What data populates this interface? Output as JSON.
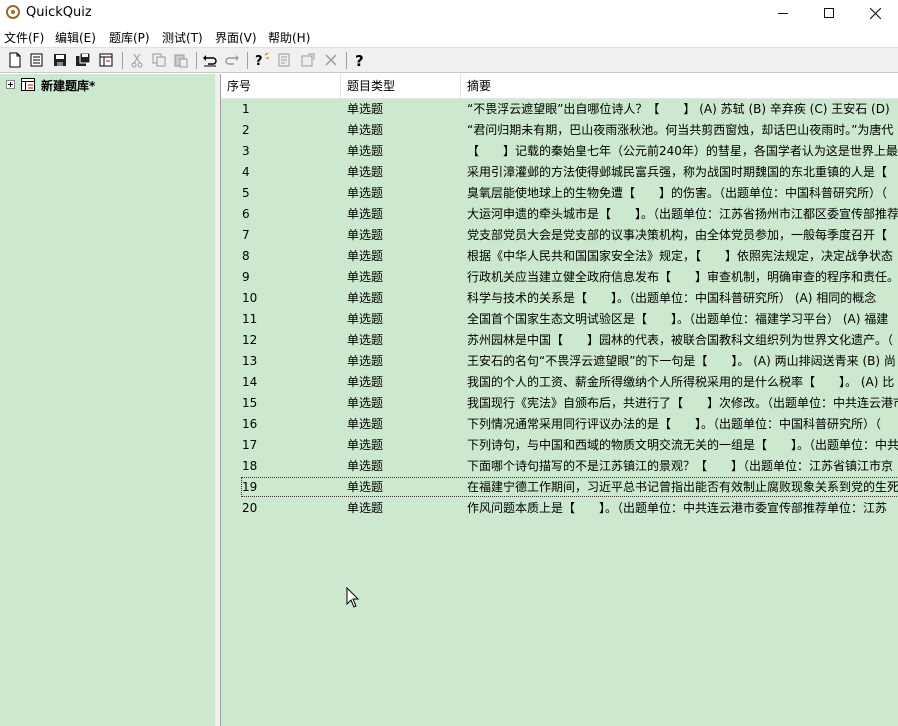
{
  "window": {
    "title": "QuickQuiz"
  },
  "menu": [
    {
      "label": "文件(F)"
    },
    {
      "label": "编辑(E)"
    },
    {
      "label": "题库(P)"
    },
    {
      "label": "测试(T)"
    },
    {
      "label": "界面(V)"
    },
    {
      "label": "帮助(H)"
    }
  ],
  "tree": {
    "root_label": "新建题库*"
  },
  "list": {
    "columns": [
      "序号",
      "题目类型",
      "摘要"
    ],
    "rows": [
      {
        "num": "1",
        "type": "单选题",
        "summary": "“不畏浮云遮望眼”出自哪位诗人？【　　】 (A) 苏轼 (B) 辛弃疾 (C) 王安石 (D)"
      },
      {
        "num": "2",
        "type": "单选题",
        "summary": "“君问归期未有期，巴山夜雨涨秋池。何当共剪西窗烛，却话巴山夜雨时。”为唐代"
      },
      {
        "num": "3",
        "type": "单选题",
        "summary": "【　　】记载的秦始皇七年（公元前240年）的彗星，各国学者认为这是世界上最早"
      },
      {
        "num": "4",
        "type": "单选题",
        "summary": "采用引漳灌邺的方法使得邺城民富兵强，称为战国时期魏国的东北重镇的人是【"
      },
      {
        "num": "5",
        "type": "单选题",
        "summary": "臭氧层能使地球上的生物免遭【　　】的伤害。（出题单位：中国科普研究所）（"
      },
      {
        "num": "6",
        "type": "单选题",
        "summary": "大运河申遗的牵头城市是【　　】。（出题单位：江苏省扬州市江都区委宣传部推荐"
      },
      {
        "num": "7",
        "type": "单选题",
        "summary": "党支部党员大会是党支部的议事决策机构，由全体党员参加，一般每季度召开【"
      },
      {
        "num": "8",
        "type": "单选题",
        "summary": "根据《中华人民共和国国家安全法》规定，【　　】依照宪法规定，决定战争状态"
      },
      {
        "num": "9",
        "type": "单选题",
        "summary": "行政机关应当建立健全政府信息发布【　　】审查机制，明确审查的程序和责任。"
      },
      {
        "num": "10",
        "type": "单选题",
        "summary": "科学与技术的关系是【　　】。（出题单位：中国科普研究所） (A) 相同的概念"
      },
      {
        "num": "11",
        "type": "单选题",
        "summary": "全国首个国家生态文明试验区是【　　】。（出题单位：福建学习平台） (A) 福建"
      },
      {
        "num": "12",
        "type": "单选题",
        "summary": "苏州园林是中国【　　】园林的代表，被联合国教科文组织列为世界文化遗产。（"
      },
      {
        "num": "13",
        "type": "单选题",
        "summary": "王安石的名句“不畏浮云遮望眼”的下一句是【　　】。 (A) 两山排闼送青来 (B) 尚"
      },
      {
        "num": "14",
        "type": "单选题",
        "summary": "我国的个人的工资、薪金所得缴纳个人所得税采用的是什么税率【　　】。 (A) 比"
      },
      {
        "num": "15",
        "type": "单选题",
        "summary": "我国现行《宪法》自颁布后，共进行了【　　】次修改。（出题单位：中共连云港市"
      },
      {
        "num": "16",
        "type": "单选题",
        "summary": "下列情况通常采用同行评议办法的是【　　】。（出题单位：中国科普研究所）（"
      },
      {
        "num": "17",
        "type": "单选题",
        "summary": "下列诗句，与中国和西域的物质文明交流无关的一组是【　　】。（出题单位：中共"
      },
      {
        "num": "18",
        "type": "单选题",
        "summary": "下面哪个诗句描写的不是江苏镇江的景观？【　　】（出题单位：江苏省镇江市京"
      },
      {
        "num": "19",
        "type": "单选题",
        "summary": "在福建宁德工作期间，习近平总书记曾指出能否有效制止腐败现象关系到党的生死"
      },
      {
        "num": "20",
        "type": "单选题",
        "summary": "作风问题本质上是【　　】。（出题单位：中共连云港市委宣传部推荐单位：江苏"
      }
    ],
    "focused_row": 19
  },
  "colors": {
    "panel_bg": "#cce8cf",
    "toolbar_bg": "#f0f0f0"
  },
  "toolbar_icons": [
    "new-file-icon",
    "open-icon",
    "save-icon",
    "save-all-icon",
    "bank-icon",
    "cut-icon",
    "copy-icon",
    "paste-icon",
    "undo-icon",
    "redo-icon",
    "add-question-icon",
    "edit-question-icon",
    "properties-icon",
    "delete-icon",
    "help-icon"
  ]
}
